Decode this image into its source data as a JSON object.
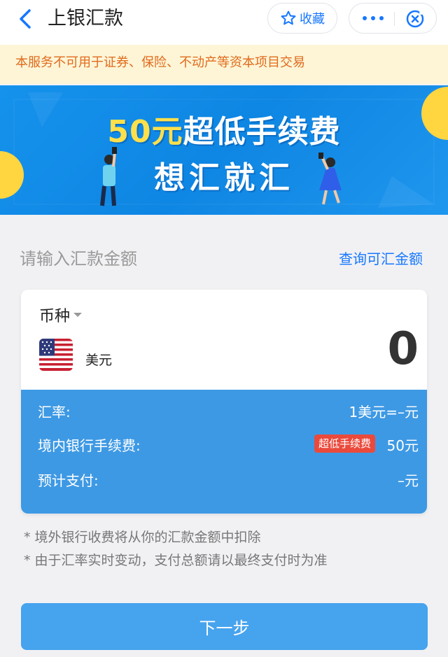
{
  "nav": {
    "title": "上银汇款",
    "favorite_label": "收藏",
    "more_icon": "more-dots-icon",
    "close_icon": "mini-app-close-icon"
  },
  "notice": "本服务不可用于证券、保险、不动产等资本项目交易",
  "banner": {
    "line1_highlight": "50元",
    "line1_rest": "超低手续费",
    "line2": "想汇就汇"
  },
  "form": {
    "prompt": "请输入汇款金额",
    "query_link": "查询可汇金额",
    "currency_label": "币种",
    "currency_name": "美元",
    "amount": "0"
  },
  "details": {
    "rate_label": "汇率:",
    "rate_value": "1美元=–元",
    "fee_label": "境内银行手续费:",
    "fee_badge": "超低手续费",
    "fee_value": "50元",
    "estimate_label": "预计支付:",
    "estimate_value": "–元"
  },
  "tips": [
    "* 境外银行收费将从你的汇款金额中扣除",
    "* 由于汇率实时变动，支付总额请以最终支付时为准"
  ],
  "next_button": "下一步",
  "colors": {
    "accent": "#1677ff",
    "card_blue": "#3e99e4",
    "button_blue": "#46a3ee",
    "notice_bg": "#fdf5d6",
    "notice_text": "#e16b1d",
    "badge_red": "#ea4a3c"
  }
}
